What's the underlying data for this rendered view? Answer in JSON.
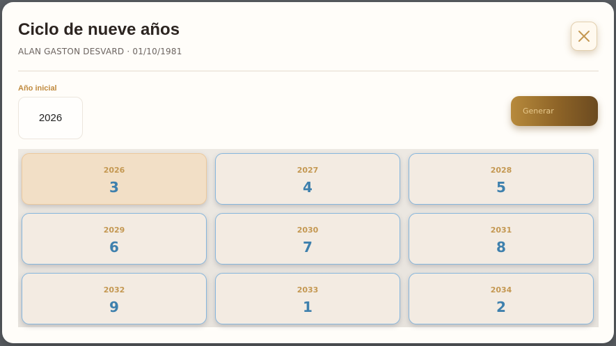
{
  "modal": {
    "title": "Ciclo de nueve años",
    "subtitle": "ALAN GASTON DESVARD · 01/10/1981"
  },
  "form": {
    "start_year_label": "Año inicial",
    "start_year_value": "2026",
    "generate_label": "Generar"
  },
  "cycle": [
    {
      "year": "2026",
      "number": "3",
      "active": true
    },
    {
      "year": "2027",
      "number": "4"
    },
    {
      "year": "2028",
      "number": "5"
    },
    {
      "year": "2029",
      "number": "6"
    },
    {
      "year": "2030",
      "number": "7"
    },
    {
      "year": "2031",
      "number": "8"
    },
    {
      "year": "2032",
      "number": "9"
    },
    {
      "year": "2033",
      "number": "1"
    },
    {
      "year": "2034",
      "number": "2"
    }
  ],
  "icons": {
    "close": "close-icon"
  },
  "colors": {
    "accent_gold": "#c08a3e",
    "number_blue": "#3e80ad",
    "card_border_blue": "#86b6dd",
    "active_card_bg": "#f2dfc6"
  }
}
